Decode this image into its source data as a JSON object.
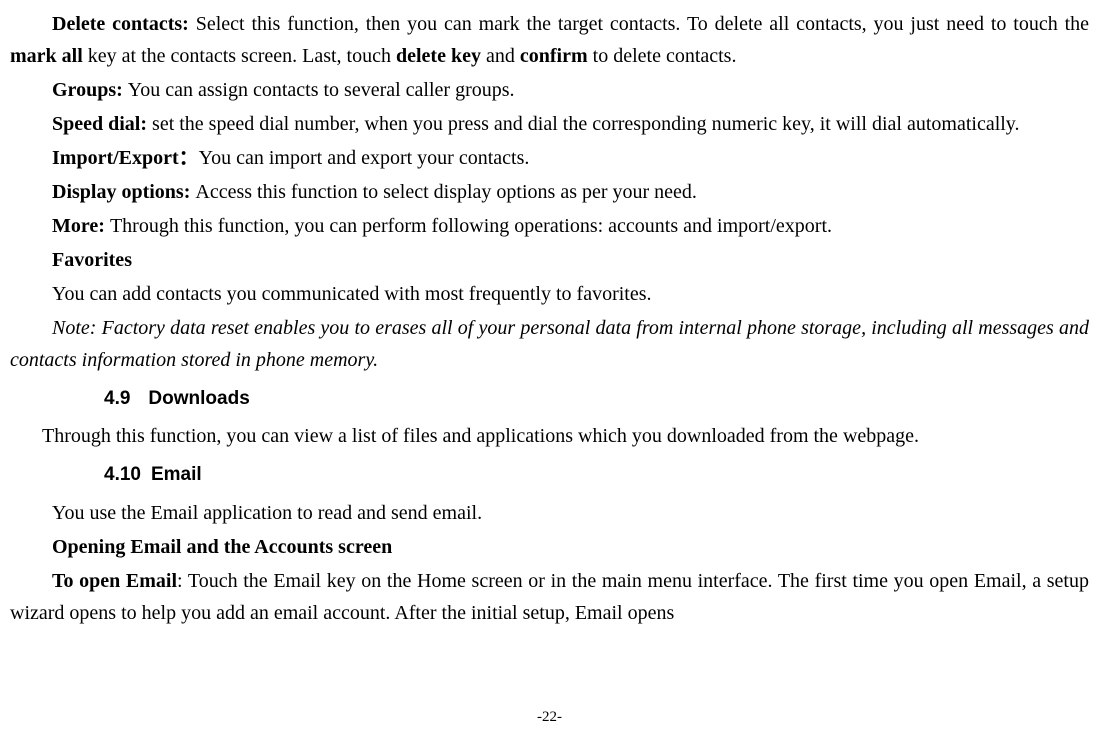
{
  "paragraphs": {
    "delete_contacts": {
      "label": "Delete contacts: ",
      "text_part1": "Select this function, then you can mark the target contacts. To delete all contacts, you just need to touch the ",
      "bold1": "mark all",
      "text_part2": " key at the contacts screen. Last, touch ",
      "bold2": "delete key",
      "text_part3": " and ",
      "bold3": "confirm",
      "text_part4": " to delete contacts."
    },
    "groups": {
      "label": "Groups: ",
      "text": "You can assign contacts to several caller groups."
    },
    "speed_dial": {
      "label": "Speed dial: ",
      "text": "set the speed dial number, when you press and dial the corresponding numeric key, it will dial automatically."
    },
    "import_export": {
      "label": "Import/Export：",
      "text": "You can import and export your contacts."
    },
    "display_options": {
      "label": "Display options: ",
      "text": "Access this function to select display options as per your need."
    },
    "more": {
      "label": "More: ",
      "text": "Through this function, you can perform following operations: accounts and import/export."
    },
    "favorites": {
      "label": "Favorites",
      "text": "You can add contacts you communicated with most frequently to favorites."
    },
    "note": {
      "text": "Note: Factory data reset enables you to erases all of your personal data from internal phone storage, including all messages and contacts information stored in phone memory."
    }
  },
  "sections": {
    "downloads": {
      "number": "4.9",
      "title": "Downloads",
      "content": "Through this function, you can view a list of files and applications which you downloaded from the webpage."
    },
    "email": {
      "number": "4.10",
      "title": "Email",
      "intro": "You use the Email application to read and send email.",
      "opening_heading": "Opening Email and the Accounts screen",
      "to_open_label": "To open Email",
      "to_open_text": ": Touch the Email key on the Home screen or in the main menu interface. The first time you open Email, a setup wizard opens to help you add an email account. After the initial setup, Email opens"
    }
  },
  "page_number": "-22-"
}
